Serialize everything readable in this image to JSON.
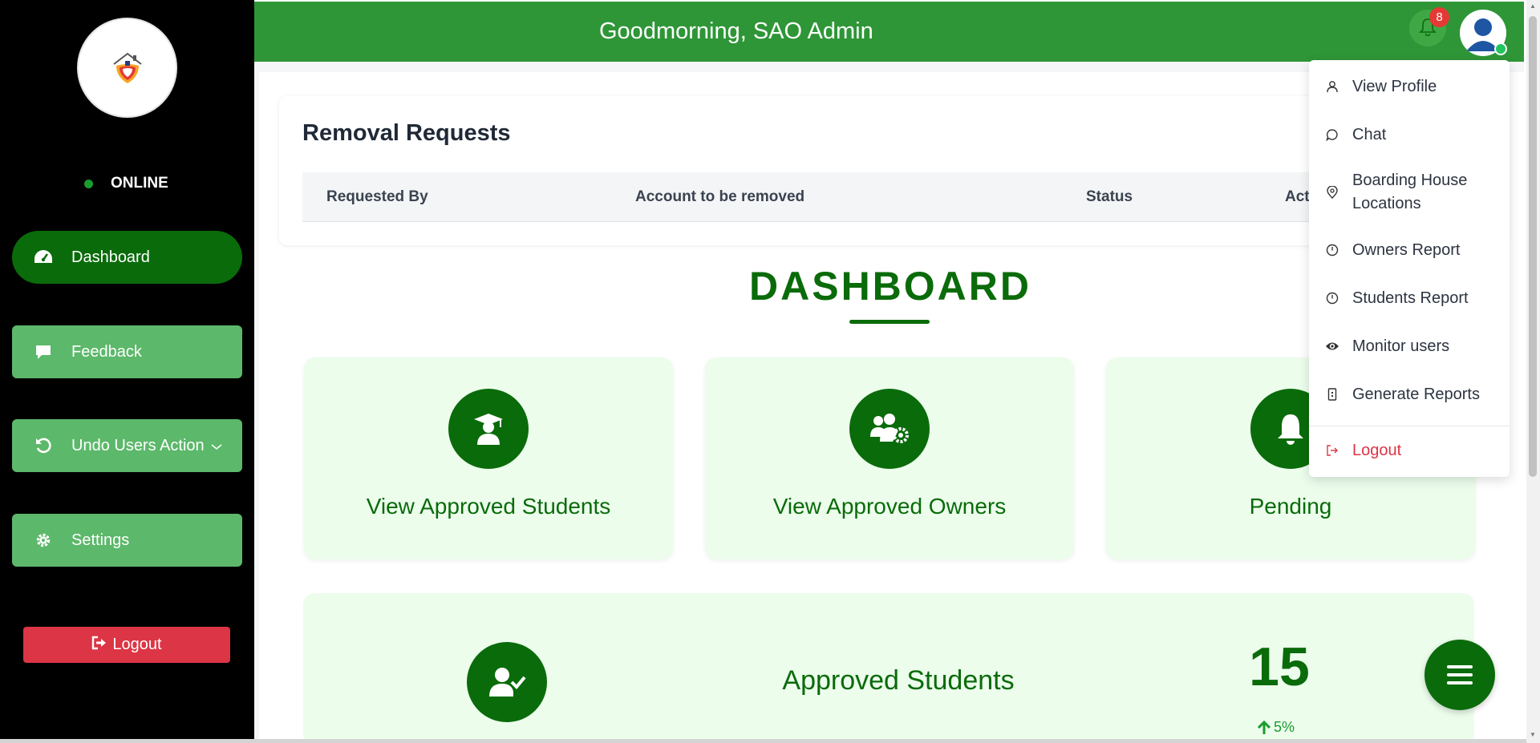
{
  "colors": {
    "sidebar_bg": "#000000",
    "header_bg": "#2e9637",
    "primary_green": "#0a6b0a",
    "nav_button_green": "#5cb86a",
    "logout_red": "#dc3545",
    "tile_bg": "#ecfdec",
    "badge_red": "#e53935",
    "online_green": "#1a9c2e"
  },
  "sidebar": {
    "status": "ONLINE",
    "nav": [
      {
        "label": "Dashboard",
        "icon": "tachometer-icon",
        "active": true
      },
      {
        "label": "Feedback",
        "icon": "comment-icon",
        "active": false
      },
      {
        "label": "Undo Users Action",
        "icon": "undo-icon",
        "active": false
      },
      {
        "label": "Settings",
        "icon": "gear-icon",
        "active": false
      }
    ],
    "logout": "Logout"
  },
  "header": {
    "greeting": "Goodmorning, SAO Admin",
    "notification_count": "8"
  },
  "removal_requests": {
    "title": "Removal Requests",
    "columns": [
      "Requested By",
      "Account to be removed",
      "Status",
      "Actions"
    ]
  },
  "dashboard": {
    "title": "DASHBOARD",
    "tiles": [
      {
        "label": "View Approved Students",
        "icon": "graduate-icon"
      },
      {
        "label": "View Approved Owners",
        "icon": "users-gear-icon"
      },
      {
        "label": "Pending",
        "icon": "bell-icon"
      }
    ],
    "stat": {
      "label": "Approved Students",
      "value": "15",
      "trend": "5%",
      "icon": "user-check-icon"
    }
  },
  "user_menu": {
    "items": [
      {
        "label": "View Profile",
        "icon": "user-icon"
      },
      {
        "label": "Chat",
        "icon": "chat-icon"
      },
      {
        "label": "Boarding House Locations",
        "icon": "map-pin-icon"
      },
      {
        "label": "Owners Report",
        "icon": "clock-icon"
      },
      {
        "label": "Students Report",
        "icon": "clock-icon"
      },
      {
        "label": "Monitor users",
        "icon": "eye-icon"
      },
      {
        "label": "Generate Reports",
        "icon": "file-icon"
      }
    ],
    "logout": "Logout"
  }
}
